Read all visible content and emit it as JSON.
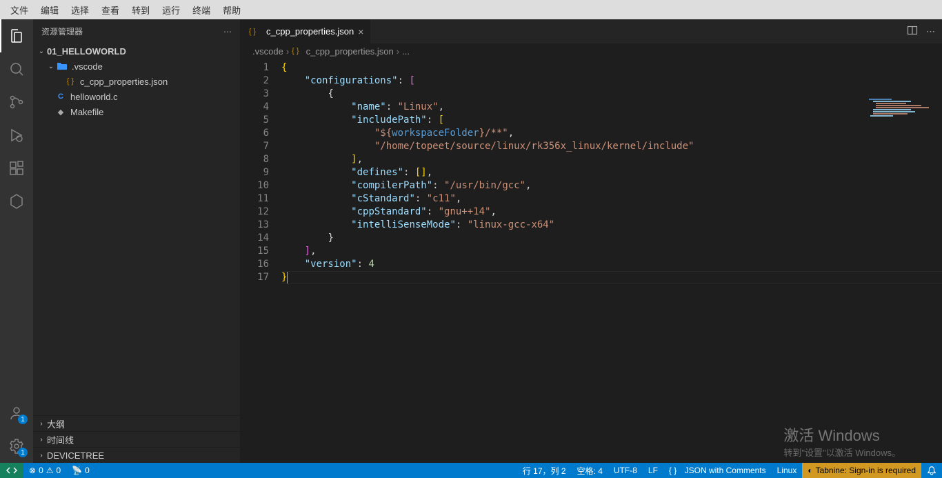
{
  "menubar": [
    "文件",
    "编辑",
    "选择",
    "查看",
    "转到",
    "运行",
    "终端",
    "帮助"
  ],
  "sidebar": {
    "title": "资源管理器",
    "project": "01_HELLOWORLD",
    "vscode_folder": ".vscode",
    "files": {
      "props": "c_cpp_properties.json",
      "hello": "helloworld.c",
      "make": "Makefile"
    },
    "panels": {
      "outline": "大纲",
      "timeline": "时间线",
      "devicetree": "DEVICETREE"
    }
  },
  "tab": {
    "label": "c_cpp_properties.json"
  },
  "breadcrumbs": {
    "a": ".vscode",
    "b": "c_cpp_properties.json",
    "c": "..."
  },
  "code": {
    "lines": [
      "1",
      "2",
      "3",
      "4",
      "5",
      "6",
      "7",
      "8",
      "9",
      "10",
      "11",
      "12",
      "13",
      "14",
      "15",
      "16",
      "17"
    ],
    "configurations": "configurations",
    "name_k": "name",
    "name_v": "Linux",
    "includePath": "includePath",
    "ip1": "${",
    "ip1b": "workspaceFolder",
    "ip1c": "}/**",
    "ip2": "/home/topeet/source/linux/rk356x_linux/kernel/include",
    "defines": "defines",
    "compilerPath_k": "compilerPath",
    "compilerPath_v": "/usr/bin/gcc",
    "cStandard_k": "cStandard",
    "cStandard_v": "c11",
    "cppStandard_k": "cppStandard",
    "cppStandard_v": "gnu++14",
    "intelli_k": "intelliSenseMode",
    "intelli_v": "linux-gcc-x64",
    "version_k": "version",
    "version_v": "4"
  },
  "status": {
    "errors": "0",
    "warnings": "0",
    "port": "0",
    "pos": "行 17，列 2",
    "spaces": "空格: 4",
    "enc": "UTF-8",
    "eol": "LF",
    "lang": "JSON with Comments",
    "os": "Linux",
    "tabnine": "Tabnine: Sign-in is required"
  },
  "watermark": {
    "l1": "激活 Windows",
    "l2": "转到\"设置\"以激活 Windows。"
  },
  "badges": {
    "accounts": "1",
    "settings": "1"
  }
}
